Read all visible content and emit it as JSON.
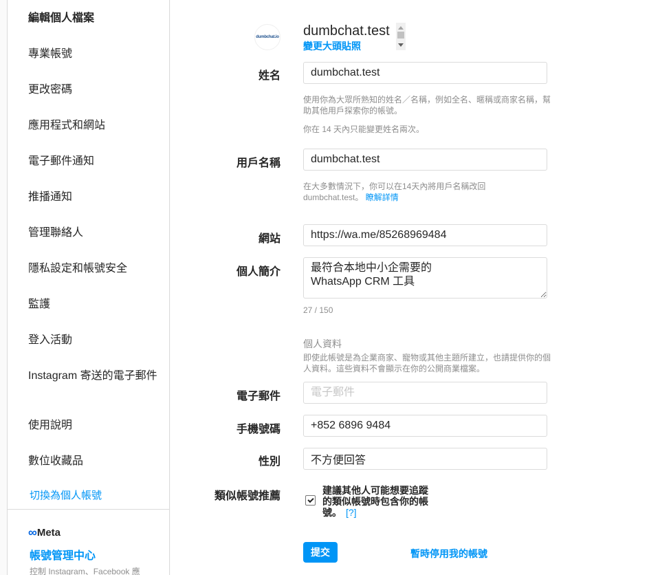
{
  "sidebar": {
    "items": [
      {
        "label": "編輯個人檔案"
      },
      {
        "label": "專業帳號"
      },
      {
        "label": "更改密碼"
      },
      {
        "label": "應用程式和網站"
      },
      {
        "label": "電子郵件通知"
      },
      {
        "label": "推播通知"
      },
      {
        "label": "管理聯絡人"
      },
      {
        "label": "隱私設定和帳號安全"
      },
      {
        "label": "監護"
      },
      {
        "label": "登入活動"
      },
      {
        "label": "Instagram 寄送的電子郵件"
      },
      {
        "label": "使用說明"
      },
      {
        "label": "數位收藏品"
      }
    ],
    "switch_label": "切換為個人帳號",
    "meta_logo": "Meta",
    "accounts_center": "帳號管理中心",
    "accounts_desc": "控制 Instagram、Facebook 應"
  },
  "profile": {
    "avatar_text": "dumbchat.io",
    "username": "dumbchat.test",
    "change_photo": "變更大頭貼照"
  },
  "form": {
    "name_label": "姓名",
    "name_value": "dumbchat.test",
    "name_help1": "使用你為大眾所熟知的姓名／名稱，例如全名、暱稱或商家名稱，幫助其他用戶探索你的帳號。",
    "name_help2": "你在 14 天內只能變更姓名兩次。",
    "username_label": "用戶名稱",
    "username_value": "dumbchat.test",
    "username_help_a": "在大多數情況下，你可以在14天內將用戶名稱改回",
    "username_help_b": "dumbchat.test。",
    "username_help_link": "瞭解詳情",
    "website_label": "網站",
    "website_value": "https://wa.me/85268969484",
    "bio_label": "個人簡介",
    "bio_value": "最符合本地中小企需要的\nWhatsApp CRM 工具",
    "bio_counter": "27 / 150",
    "personal_title": "個人資料",
    "personal_help": "即使此帳號是為企業商家、寵物或其他主題所建立，也請提供你的個人資料。這些資料不會顯示在你的公開商業檔案。",
    "email_label": "電子郵件",
    "email_placeholder": "電子郵件",
    "phone_label": "手機號碼",
    "phone_value": "+852 6896 9484",
    "gender_label": "性別",
    "gender_value": "不方便回答",
    "suggest_label": "類似帳號推薦",
    "suggest_text": "建議其他人可能想要追蹤的類似帳號時包含你的帳號。",
    "suggest_help": "[?]",
    "suggest_checked": true,
    "submit_label": "提交",
    "disable_label": "暫時停用我的帳號"
  },
  "colors": {
    "accent": "#0095f6",
    "text": "#262626",
    "muted": "#8e8e8e",
    "border": "#dbdbdb"
  }
}
